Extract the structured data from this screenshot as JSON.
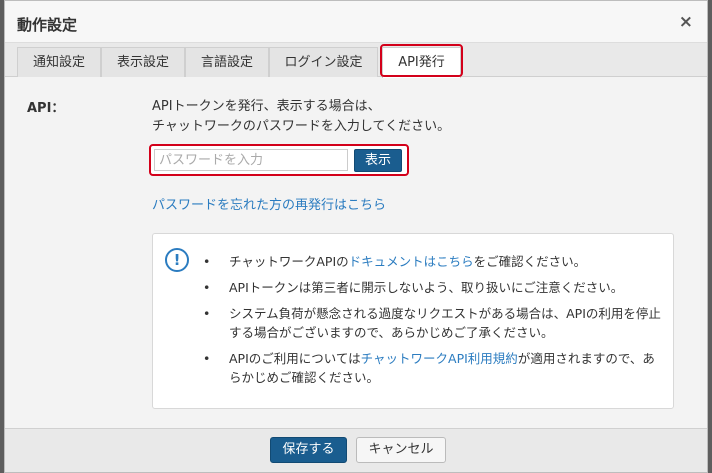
{
  "dialog": {
    "title": "動作設定",
    "close_label": "×"
  },
  "tabs": [
    {
      "label": "通知設定",
      "active": false
    },
    {
      "label": "表示設定",
      "active": false
    },
    {
      "label": "言語設定",
      "active": false
    },
    {
      "label": "ログイン設定",
      "active": false
    },
    {
      "label": "API発行",
      "active": true
    }
  ],
  "api": {
    "label": "API：",
    "description_line1": "APIトークンを発行、表示する場合は、",
    "description_line2": "チャットワークのパスワードを入力してください。",
    "password_placeholder": "パスワードを入力",
    "password_value": "",
    "show_button": "表示",
    "reissue_link": "パスワードを忘れた方の再発行はこちら"
  },
  "notice": {
    "icon": "exclamation-circle-icon",
    "icon_glyph": "!",
    "bullet": "•",
    "items": [
      {
        "pre": "チャットワークAPIの",
        "link": "ドキュメントはこちら",
        "post": "をご確認ください。"
      },
      {
        "text": "APIトークンは第三者に開示しないよう、取り扱いにご注意ください。"
      },
      {
        "text": "システム負荷が懸念される過度なリクエストがある場合は、APIの利用を停止する場合がございますので、あらかじめご了承ください。"
      },
      {
        "pre": "APIのご利用については",
        "link": "チャットワークAPI利用規約",
        "post": "が適用されますので、あらかじめご確認ください。"
      }
    ]
  },
  "footer": {
    "save_button": "保存する",
    "cancel_button": "キャンセル"
  },
  "colors": {
    "primary_button": "#1a5d8f",
    "link": "#2b7cc0",
    "highlight": "#d3001a"
  }
}
